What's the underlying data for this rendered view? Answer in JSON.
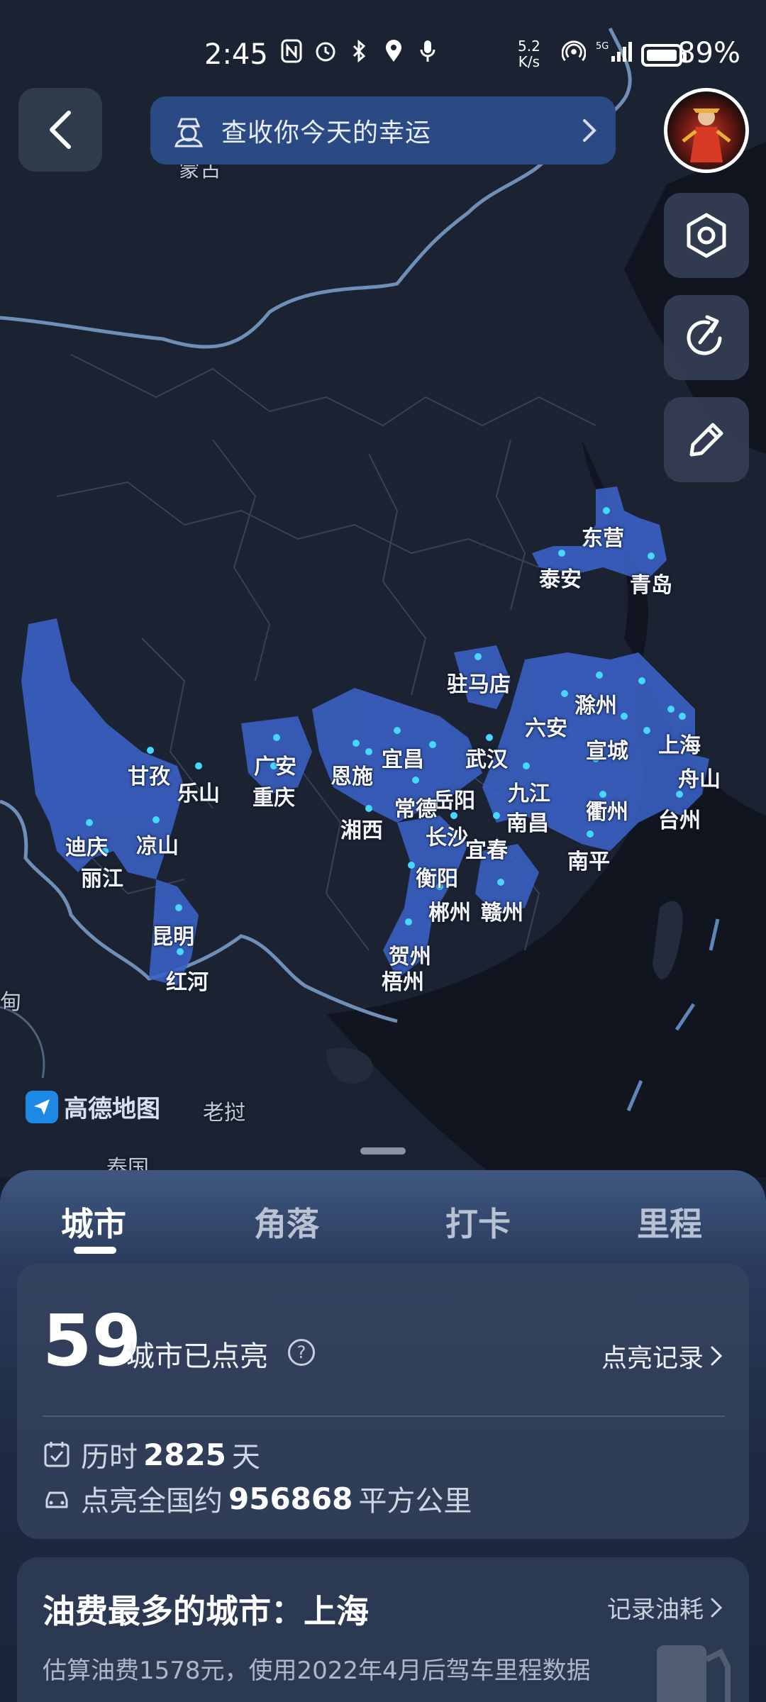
{
  "status_bar": {
    "time": "2:45",
    "net_speed_value": "5.2",
    "net_speed_unit": "K/s",
    "battery": "89%",
    "icons": [
      "nfc-icon",
      "alarm-icon",
      "bluetooth-icon",
      "location-icon",
      "mic-icon",
      "hotspot-icon",
      "signal-5g-icon",
      "battery-icon"
    ]
  },
  "top": {
    "luck_text": "查收你今天的幸运",
    "side_buttons": [
      "settings-icon",
      "share-icon",
      "edit-icon"
    ]
  },
  "map": {
    "provider": "高德地图",
    "context_labels": [
      "蒙古",
      "老挝",
      "泰国",
      "甸"
    ],
    "cities": [
      "东营",
      "泰安",
      "青岛",
      "驻马店",
      "滁州",
      "六安",
      "宣城",
      "上海",
      "舟山",
      "武汉",
      "九江",
      "衢州",
      "台州",
      "宜昌",
      "岳阳",
      "常德",
      "南昌",
      "长沙",
      "宜春",
      "南平",
      "恩施",
      "湘西",
      "广安",
      "重庆",
      "甘孜",
      "乐山",
      "凉山",
      "迪庆",
      "丽江",
      "昆明",
      "红河",
      "衡阳",
      "郴州",
      "赣州",
      "贺州",
      "梧州"
    ]
  },
  "tabs": [
    "城市",
    "角落",
    "打卡",
    "里程"
  ],
  "summary": {
    "count": "59",
    "count_label": "城市已点亮",
    "record_link": "点亮记录",
    "days_prefix": "历时",
    "days": "2825",
    "days_unit": "天",
    "area_prefix": "点亮全国约",
    "area": "956868",
    "area_unit": "平方公里"
  },
  "fuel": {
    "title": "油费最多的城市：上海",
    "link": "记录油耗",
    "desc": "估算油费1578元，使用2022年4月后驾车里程数据"
  }
}
